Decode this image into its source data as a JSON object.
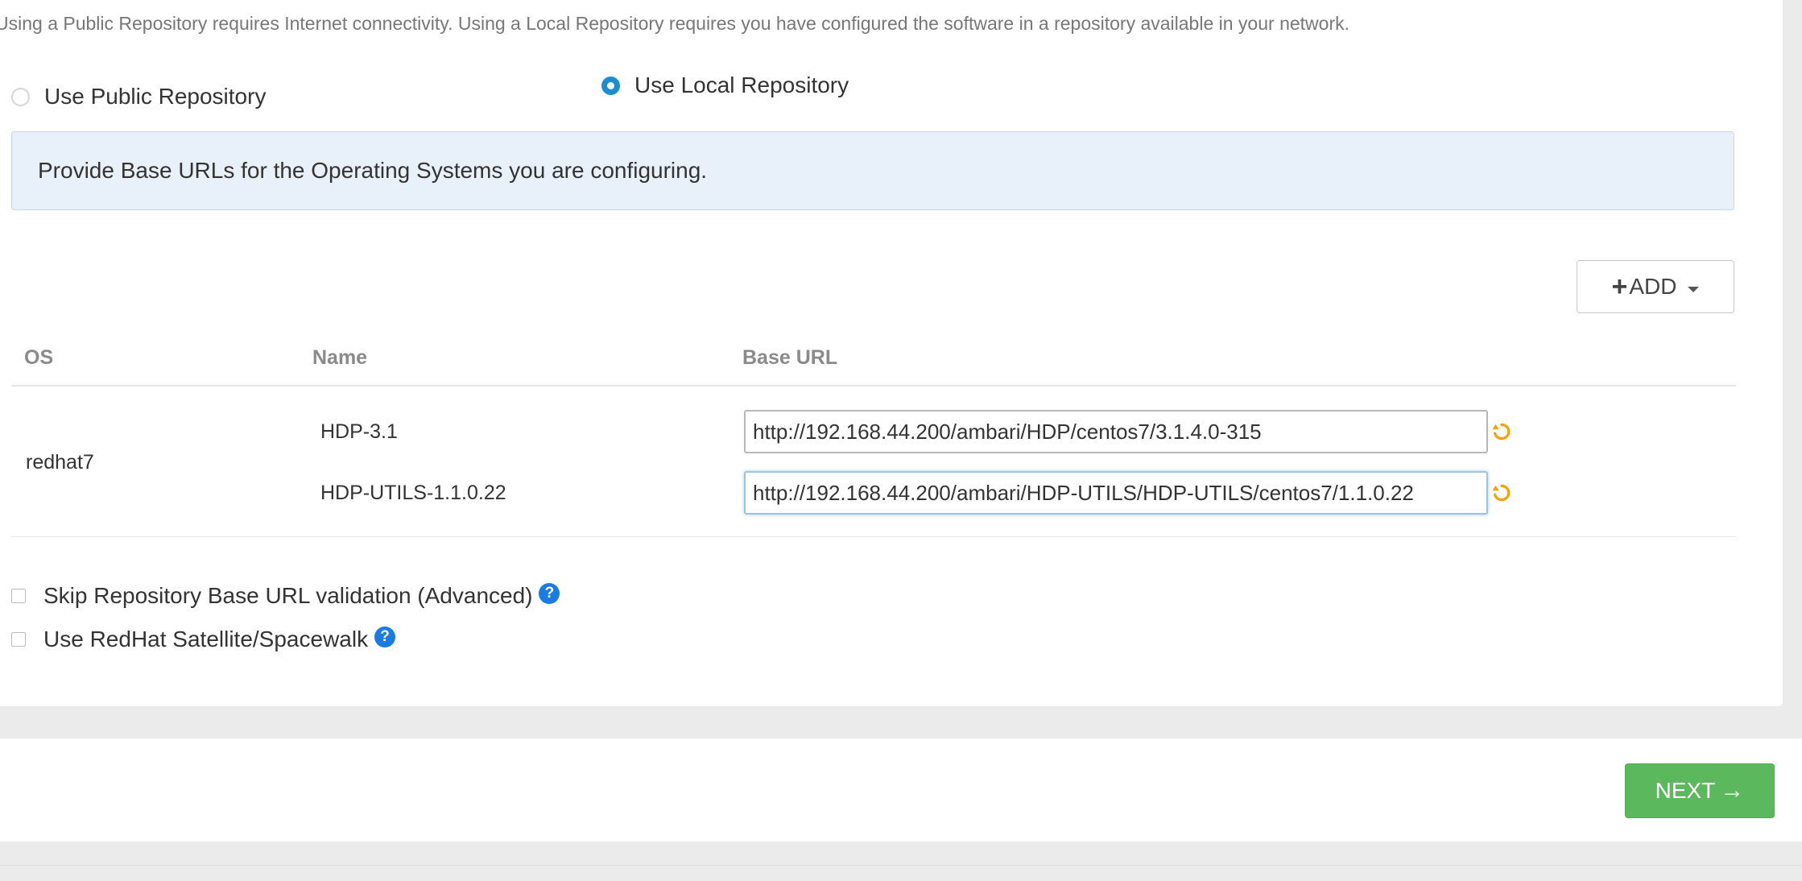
{
  "intro_text": "Using a Public Repository requires Internet connectivity. Using a Local Repository requires you have configured the software in a repository available in your network.",
  "repo_options": {
    "public_label": "Use Public Repository",
    "local_label": "Use Local Repository",
    "selected": "local"
  },
  "info_banner": "Provide Base URLs for the Operating Systems you are configuring.",
  "add_button": {
    "label": "ADD"
  },
  "table": {
    "headers": {
      "os": "OS",
      "name": "Name",
      "base_url": "Base URL"
    },
    "os": "redhat7",
    "rows": [
      {
        "name": "HDP-3.1",
        "base_url": "http://192.168.44.200/ambari/HDP/centos7/3.1.4.0-315"
      },
      {
        "name": "HDP-UTILS-1.1.0.22",
        "base_url": "http://192.168.44.200/ambari/HDP-UTILS/HDP-UTILS/centos7/1.1.0.22"
      }
    ]
  },
  "options": {
    "skip_validation_label": "Skip Repository Base URL validation (Advanced)",
    "satellite_label": "Use RedHat Satellite/Spacewalk"
  },
  "footer": {
    "next_label": "NEXT"
  },
  "colors": {
    "accent": "#1b8ed1",
    "info_bg": "#e8f1f9",
    "next_button": "#5cb85c",
    "undo_icon": "#f0a30a",
    "help_icon": "#1a7be0"
  },
  "icons": {
    "plus": "plus-icon",
    "caret": "caret-down-icon",
    "undo": "undo-icon",
    "help": "question-circle-icon",
    "arrow": "arrow-right-icon"
  }
}
